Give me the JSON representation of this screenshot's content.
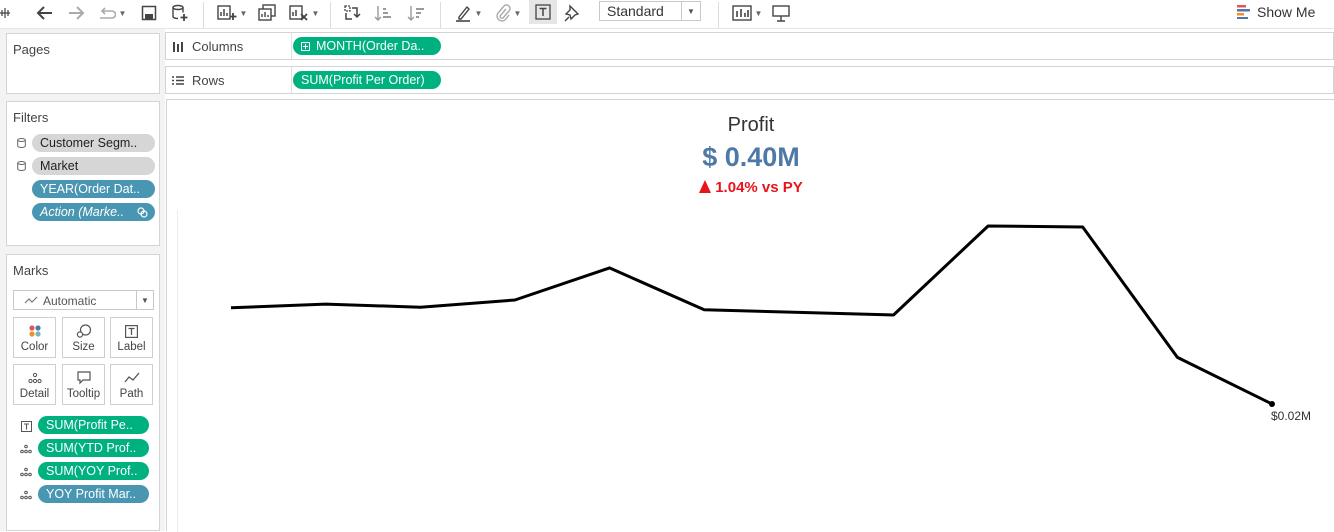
{
  "toolbar": {
    "icons": [
      "tableau-logo-icon",
      "undo-icon",
      "redo-icon",
      "replay-icon",
      "save-icon",
      "new-datasource-icon",
      "new-worksheet-icon",
      "duplicate-icon",
      "clear-sheet-icon",
      "swap-icon",
      "sort-ascending-icon",
      "sort-descending-icon",
      "highlight-icon",
      "paperclip-icon",
      "show-mark-labels-icon",
      "pin-icon",
      "show-cards-icon",
      "presentation-icon"
    ],
    "fit_select": "Standard",
    "show_me_label": "Show Me"
  },
  "pages": {
    "title": "Pages"
  },
  "filters": {
    "title": "Filters",
    "items": [
      {
        "label": "Customer Segm..",
        "icon": "database-icon",
        "color": "gray"
      },
      {
        "label": "Market",
        "icon": "database-icon",
        "color": "gray"
      },
      {
        "label": "YEAR(Order Dat..",
        "icon": "",
        "color": "blue"
      },
      {
        "label": "Action (Marke..",
        "icon": "link-icon",
        "color": "blue"
      }
    ]
  },
  "marks": {
    "title": "Marks",
    "type_select": "Automatic",
    "buttons": [
      "Color",
      "Size",
      "Label",
      "Detail",
      "Tooltip",
      "Path"
    ],
    "fields": [
      {
        "label": "SUM(Profit Pe..",
        "icon": "label-icon",
        "color": "green"
      },
      {
        "label": "SUM(YTD Prof..",
        "icon": "detail-icon",
        "color": "green"
      },
      {
        "label": "SUM(YOY Prof..",
        "icon": "detail-icon",
        "color": "green"
      },
      {
        "label": "YOY Profit Mar..",
        "icon": "detail-icon",
        "color": "blue"
      }
    ]
  },
  "shelves": {
    "columns_label": "Columns",
    "columns_pill": "MONTH(Order Da..",
    "rows_label": "Rows",
    "rows_pill": "SUM(Profit Per Order)"
  },
  "view": {
    "title": "Profit",
    "kpi_value": "$ 0.40M",
    "kpi_change": "1.04% vs PY",
    "end_label": "$0.02M",
    "colors": {
      "kpi": "#4e79a7",
      "change": "#e8141c",
      "line": "#000000",
      "green_pill": "#00b180",
      "blue_pill": "#4996b2"
    }
  },
  "chart_data": {
    "type": "line",
    "x": [
      1,
      2,
      3,
      4,
      5,
      6,
      7,
      8,
      9,
      10,
      11,
      12
    ],
    "values": [
      0.206,
      0.213,
      0.207,
      0.221,
      0.283,
      0.202,
      0.197,
      0.192,
      0.364,
      0.362,
      0.11,
      0.02
    ],
    "title": "",
    "xlabel": "",
    "ylabel": "",
    "grid": false,
    "annotations": [
      {
        "point": 12,
        "text": "$0.02M"
      }
    ]
  }
}
